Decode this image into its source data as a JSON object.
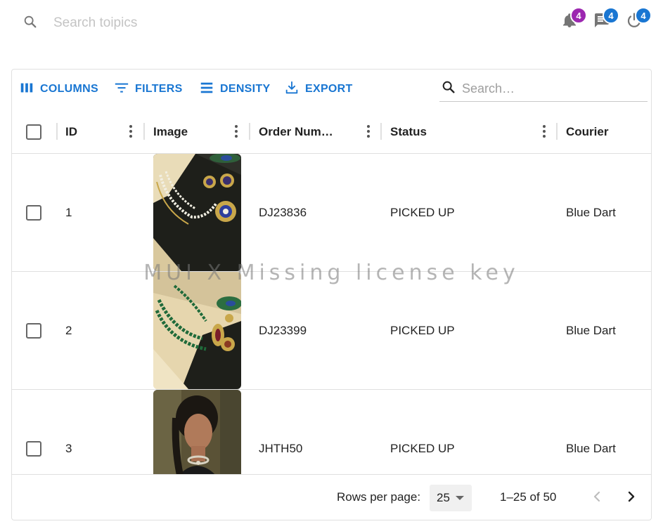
{
  "topbar": {
    "search_placeholder": "Search toipics",
    "notifications_count": "4",
    "messages_count": "4",
    "power_count": "4",
    "colors": {
      "notification_badge": "#9c27b0",
      "messages_badge": "#1976d2",
      "power_badge": "#1976d2"
    }
  },
  "toolbar": {
    "columns_label": "COLUMNS",
    "filters_label": "FILTERS",
    "density_label": "DENSITY",
    "export_label": "EXPORT",
    "search_placeholder": "Search…",
    "accent_color": "#1976d2"
  },
  "columns": {
    "id": "ID",
    "image": "Image",
    "order_number": "Order Num…",
    "status": "Status",
    "courier": "Courier"
  },
  "rows": [
    {
      "id": "1",
      "image": "necklace-pearl-blue-stone",
      "order_number": "DJ23836",
      "status": "PICKED UP",
      "courier": "Blue Dart"
    },
    {
      "id": "2",
      "image": "necklace-green-beads",
      "order_number": "DJ23399",
      "status": "PICKED UP",
      "courier": "Blue Dart"
    },
    {
      "id": "3",
      "image": "woman-wearing-choker",
      "order_number": "JHTH50",
      "status": "PICKED UP",
      "courier": "Blue Dart"
    }
  ],
  "watermark": "MUI X Missing license key",
  "footer": {
    "rows_per_page_label": "Rows per page:",
    "rows_per_page_value": "25",
    "range_text": "1–25 of 50"
  }
}
